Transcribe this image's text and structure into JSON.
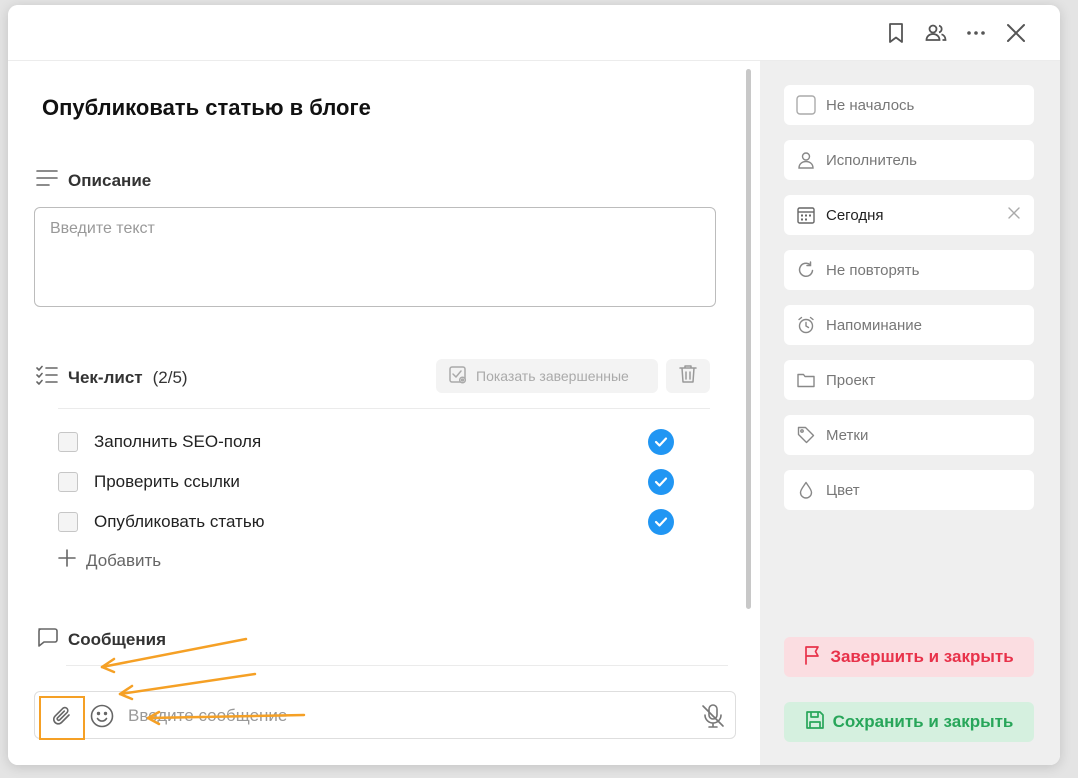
{
  "task": {
    "title": "Опубликовать статью в блоге"
  },
  "description": {
    "label": "Описание",
    "placeholder": "Введите текст"
  },
  "checklist": {
    "label": "Чек-лист",
    "count": "(2/5)",
    "show_done_label": "Показать завершенные",
    "items": [
      {
        "text": "Заполнить SEO-поля",
        "done": true
      },
      {
        "text": "Проверить ссылки",
        "done": true
      },
      {
        "text": "Опубликовать статью",
        "done": true
      }
    ],
    "add_label": "Добавить"
  },
  "messages": {
    "label": "Сообщения",
    "placeholder": "Введите сообщение"
  },
  "sidebar": {
    "properties": [
      {
        "label": "Не началось",
        "icon": "checkbox-icon"
      },
      {
        "label": "Исполнитель",
        "icon": "user-icon"
      },
      {
        "label": "Сегодня",
        "icon": "calendar-icon"
      },
      {
        "label": "Не повторять",
        "icon": "repeat-icon"
      },
      {
        "label": "Напоминание",
        "icon": "alarm-icon"
      },
      {
        "label": "Проект",
        "icon": "folder-icon"
      },
      {
        "label": "Метки",
        "icon": "tag-icon"
      },
      {
        "label": "Цвет",
        "icon": "drop-icon"
      }
    ],
    "complete_label": "Завершить и закрыть",
    "save_label": "Сохранить и закрыть"
  },
  "colors": {
    "accent_blue": "#2196f3",
    "complete_red": "#e8324a",
    "save_green": "#28a65a",
    "annotation_orange": "#f5a025"
  }
}
